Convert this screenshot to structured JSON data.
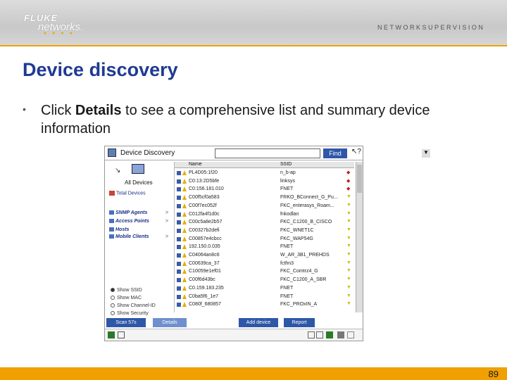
{
  "header": {
    "brand_line1": "FLUKE",
    "brand_line2": "networks.",
    "tagline": "NETWORKSUPERVISION"
  },
  "slide": {
    "title": "Device discovery",
    "bullet_pre": "Click ",
    "bullet_bold": "Details",
    "bullet_post": " to see a comprehensive list and summary device information",
    "page_number": "89"
  },
  "app": {
    "title": "Device Discovery",
    "search_value": "",
    "find_label": "Find",
    "all_devices_label": "All Devices",
    "total_devices_label": "Total Devices",
    "categories": [
      "SNMP Agents",
      "Access Points",
      "Hosts",
      "Mobile Clients"
    ],
    "radio_options": [
      "Show SSID",
      "Show MAC",
      "Show Channel-ID",
      "Show Security"
    ],
    "columns": {
      "name": "Name",
      "ssid": "SSID"
    },
    "rows": [
      {
        "name": "PL4D05:1f20",
        "ssid": "n_b-ap",
        "mark": "red"
      },
      {
        "name": "C0:13:2D5bfe",
        "ssid": "linksys",
        "mark": "red"
      },
      {
        "name": "C0:156.181.010",
        "ssid": "FNET",
        "mark": "red"
      },
      {
        "name": "C00f5cf0a583",
        "ssid": "FRKO_BConnect_G_Pu...",
        "mark": "yellow"
      },
      {
        "name": "C00f7ec052f",
        "ssid": "FKC_enterasys_Roam...",
        "mark": "yellow"
      },
      {
        "name": "C012fa4f1d0c",
        "ssid": "fnkodlan",
        "mark": "yellow"
      },
      {
        "name": "C00c5a8e2b57",
        "ssid": "FKC_C1200_B_CISCO",
        "mark": "yellow"
      },
      {
        "name": "C00327b2defi",
        "ssid": "FKC_WNET1C",
        "mark": "yellow"
      },
      {
        "name": "C00857e4cbcc",
        "ssid": "FKC_WAP54G",
        "mark": "yellow"
      },
      {
        "name": "192.150.0.035",
        "ssid": "FNET",
        "mark": "yellow"
      },
      {
        "name": "C04064an8c6",
        "ssid": "W_AR_3B1_PREHDS",
        "mark": "yellow"
      },
      {
        "name": "C00639ca_37",
        "ssid": "fcthn3",
        "mark": "yellow"
      },
      {
        "name": "C10059e1ef01",
        "ssid": "FKC_Comtrz4_G",
        "mark": "yellow"
      },
      {
        "name": "C00f6d43bc",
        "ssid": "FKC_C1200_A_SBR",
        "mark": "yellow"
      },
      {
        "name": "C0.159.183.235",
        "ssid": "FNET",
        "mark": "yellow"
      },
      {
        "name": "C0ba5f6_1e7",
        "ssid": "FNET",
        "mark": "yellow"
      },
      {
        "name": "C080f_680857",
        "ssid": "FKC_PROxIN_A",
        "mark": "yellow"
      }
    ],
    "buttons": [
      "Scan 57s",
      "Details",
      "Add device",
      "Report"
    ]
  },
  "colors": {
    "title": "#1f3a93",
    "accent": "#f0a000",
    "button": "#2e57a8"
  }
}
